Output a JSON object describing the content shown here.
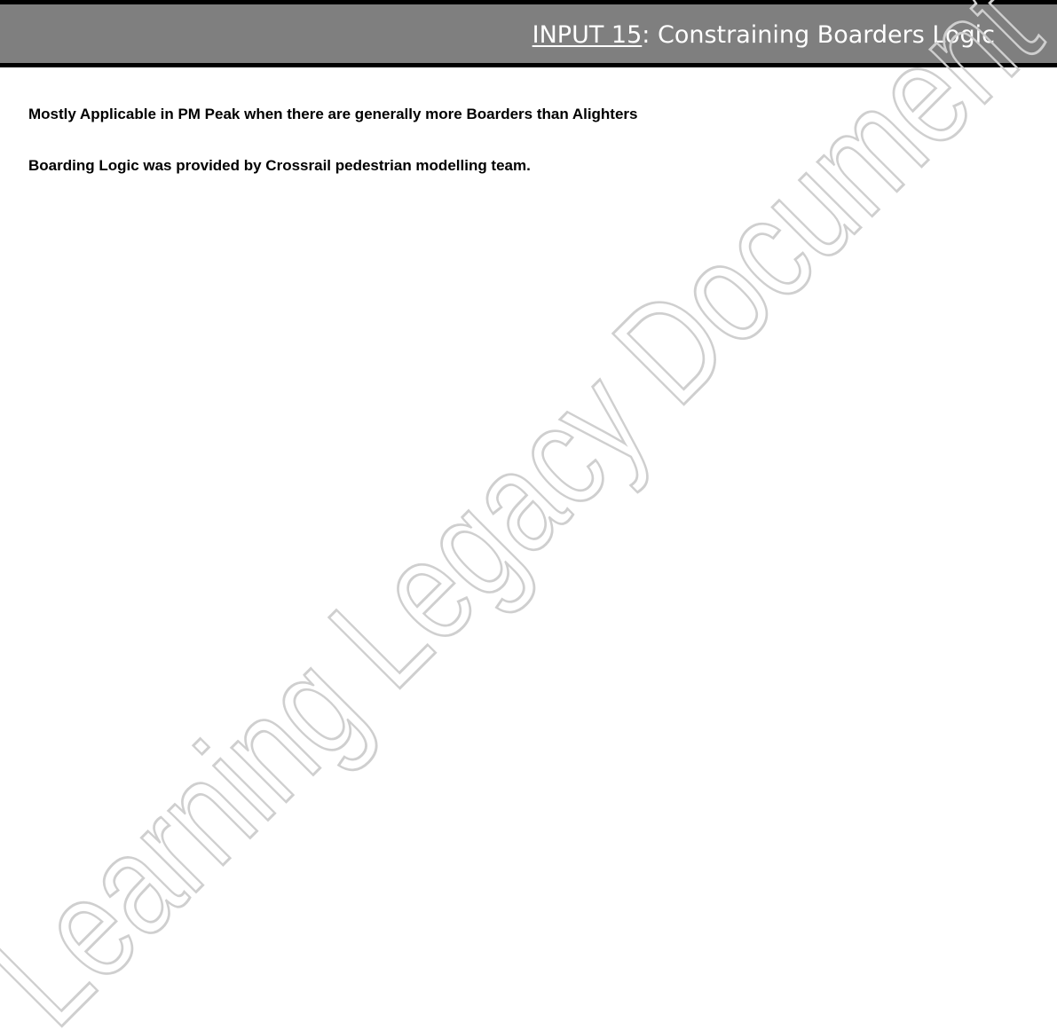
{
  "header": {
    "title_ref": "INPUT 15",
    "title_separator": ": ",
    "title_text": "Constraining Boarders Logic"
  },
  "body": {
    "line_1": "Mostly Applicable in PM Peak when there are generally more Boarders than Alighters",
    "line_2": "Boarding Logic was provided by Crossrail pedestrian modelling team."
  },
  "watermark": {
    "text": "Learning Legacy Document"
  },
  "colors": {
    "header_background": "#7f7f7f",
    "header_border": "#000000",
    "header_text": "#ffffff",
    "body_text": "#000000",
    "watermark_stroke": "#cfcfcf"
  }
}
